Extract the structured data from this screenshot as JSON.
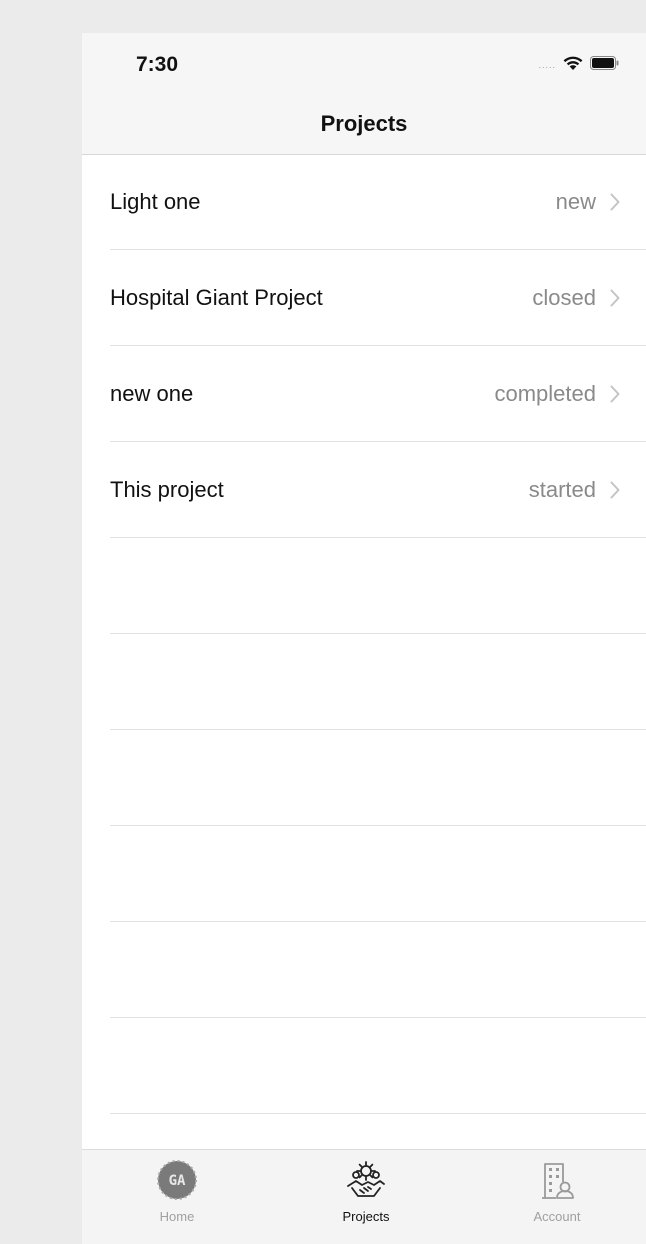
{
  "status_bar": {
    "time": "7:30",
    "signal": "....."
  },
  "nav": {
    "title": "Projects"
  },
  "projects": [
    {
      "name": "Light one",
      "status": "new"
    },
    {
      "name": "Hospital Giant Project",
      "status": "closed"
    },
    {
      "name": "new one",
      "status": "completed"
    },
    {
      "name": "This project",
      "status": "started"
    }
  ],
  "tabbar": {
    "home": {
      "label": "Home",
      "badge": "GA",
      "icon": "home-logo-icon"
    },
    "projects": {
      "label": "Projects",
      "icon": "handshake-gear-icon",
      "active": true
    },
    "account": {
      "label": "Account",
      "icon": "building-user-icon"
    }
  },
  "colors": {
    "background": "#ebebeb",
    "header": "#f6f6f6",
    "secondary_text": "#8a8a8a",
    "inactive_tab": "#a0a0a0"
  }
}
